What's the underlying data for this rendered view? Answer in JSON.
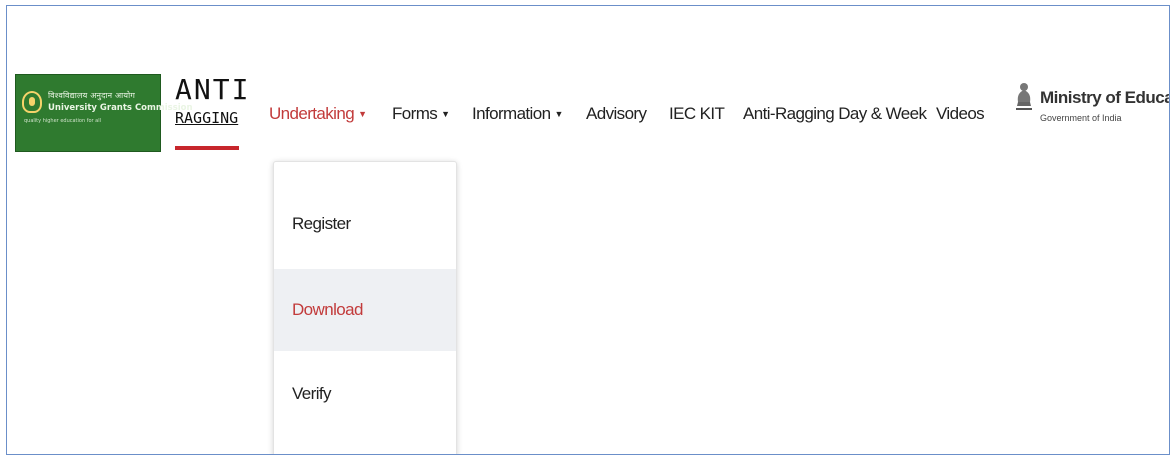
{
  "brand": {
    "ugc_hindi": "विश्वविद्यालय अनुदान आयोग",
    "ugc_name": "University Grants Commission",
    "ugc_tagline": "quality higher education for all",
    "anti_ragging_top": "ANTI",
    "anti_ragging_bottom": "RAGGING",
    "moe_title": "Ministry of Education",
    "moe_subtitle": "Government of India"
  },
  "nav": {
    "items": [
      {
        "label": "Undertaking",
        "has_caret": true,
        "active": true
      },
      {
        "label": "Forms",
        "has_caret": true,
        "active": false
      },
      {
        "label": "Information",
        "has_caret": true,
        "active": false
      },
      {
        "label": "Advisory",
        "has_caret": false,
        "active": false
      },
      {
        "label": "IEC KIT",
        "has_caret": false,
        "active": false
      },
      {
        "label": "Anti-Ragging Day & Week",
        "has_caret": false,
        "active": false
      },
      {
        "label": "Videos",
        "has_caret": false,
        "active": false
      }
    ],
    "caret_icon": "caret-down-icon"
  },
  "dropdown": {
    "items": [
      {
        "label": "Register",
        "hovered": false
      },
      {
        "label": "Download",
        "hovered": true
      },
      {
        "label": "Verify",
        "hovered": false
      }
    ]
  },
  "colors": {
    "accent": "#c23b3b",
    "ugc_green": "#2f7a2f",
    "hover_bg": "#eef0f3",
    "frame_border": "#6b8fc9"
  }
}
